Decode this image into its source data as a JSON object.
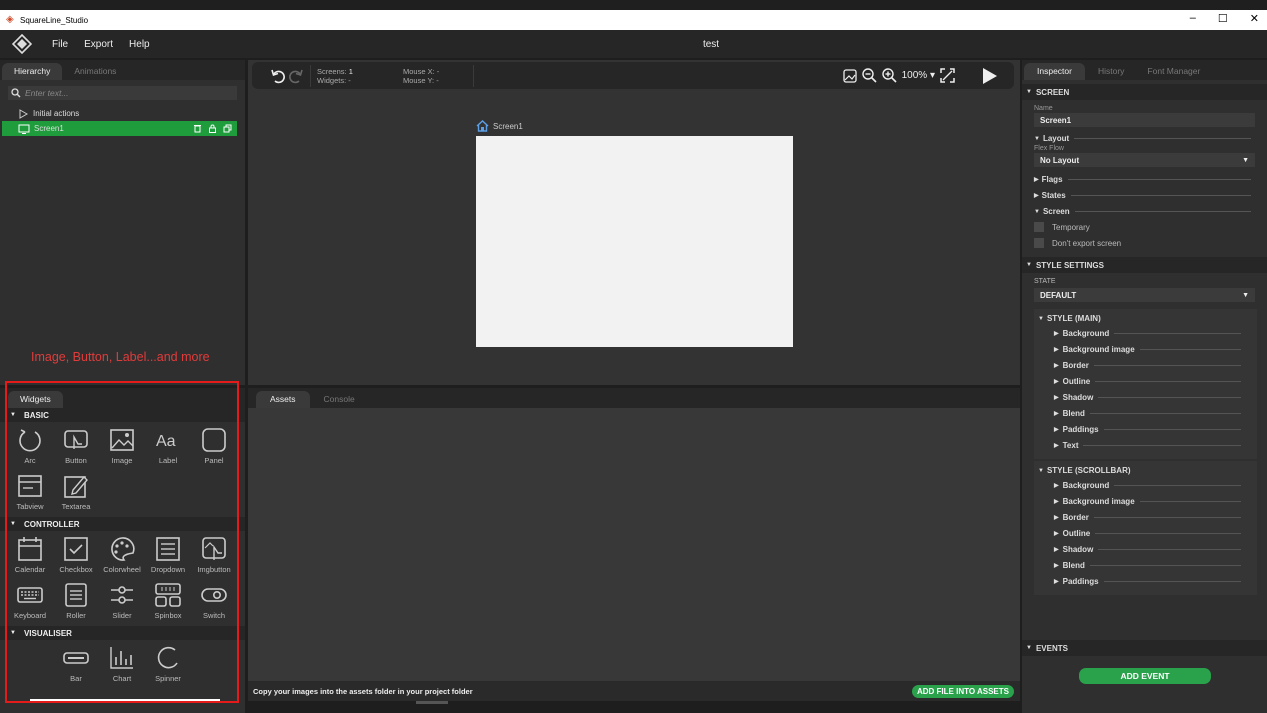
{
  "window": {
    "title": "SquareLine_Studio",
    "min": "–",
    "max": "☐",
    "close": "✕"
  },
  "menu": {
    "items": [
      "File",
      "Export",
      "Help"
    ],
    "project_name": "test"
  },
  "left": {
    "tabs": [
      "Hierarchy",
      "Animations"
    ],
    "search_placeholder": "Enter text...",
    "tree": [
      {
        "label": "Initial actions"
      },
      {
        "label": "Screen1"
      }
    ],
    "annotation": "Image, Button, Label...and more"
  },
  "widgets": {
    "tab": "Widgets",
    "sections": [
      {
        "title": "BASIC",
        "items": [
          {
            "label": "Arc",
            "icon": "arc-icon"
          },
          {
            "label": "Button",
            "icon": "button-icon"
          },
          {
            "label": "Image",
            "icon": "image-icon"
          },
          {
            "label": "Label",
            "icon": "label-icon"
          },
          {
            "label": "Panel",
            "icon": "panel-icon"
          },
          {
            "label": "Tabview",
            "icon": "tabview-icon"
          },
          {
            "label": "Textarea",
            "icon": "textarea-icon"
          }
        ]
      },
      {
        "title": "CONTROLLER",
        "items": [
          {
            "label": "Calendar",
            "icon": "calendar-icon"
          },
          {
            "label": "Checkbox",
            "icon": "checkbox-icon"
          },
          {
            "label": "Colorwheel",
            "icon": "colorwheel-icon"
          },
          {
            "label": "Dropdown",
            "icon": "dropdown-icon"
          },
          {
            "label": "Imgbutton",
            "icon": "imgbutton-icon"
          },
          {
            "label": "Keyboard",
            "icon": "keyboard-icon"
          },
          {
            "label": "Roller",
            "icon": "roller-icon"
          },
          {
            "label": "Slider",
            "icon": "slider-icon"
          },
          {
            "label": "Spinbox",
            "icon": "spinbox-icon"
          },
          {
            "label": "Switch",
            "icon": "switch-icon"
          }
        ]
      },
      {
        "title": "VISUALISER",
        "items": [
          {
            "label": "Bar",
            "icon": "bar-icon"
          },
          {
            "label": "Chart",
            "icon": "chart-icon"
          },
          {
            "label": "Spinner",
            "icon": "spinner-icon"
          }
        ]
      }
    ]
  },
  "canvas": {
    "screens_label": "Screens:",
    "screens_value": "1",
    "widgets_label": "Widgets:",
    "widgets_value": "-",
    "mouse_x": "Mouse X: -",
    "mouse_y": "Mouse Y: -",
    "zoom": "100%",
    "screen_name": "Screen1"
  },
  "assets": {
    "tabs": [
      "Assets",
      "Console"
    ],
    "hint": "Copy your images into the assets folder in your project folder",
    "add_button": "ADD FILE INTO ASSETS"
  },
  "inspector": {
    "tabs": [
      "Inspector",
      "History",
      "Font Manager"
    ],
    "screen_section": "SCREEN",
    "name_label": "Name",
    "name_value": "Screen1",
    "layout": "Layout",
    "flex_flow": "Flex Flow",
    "layout_value": "No Layout",
    "flags": "Flags",
    "states": "States",
    "screen": "Screen",
    "temporary": "Temporary",
    "dont_export": "Don't export screen",
    "style_settings": "STYLE SETTINGS",
    "state_label": "STATE",
    "state_value": "DEFAULT",
    "style_main": "STYLE (MAIN)",
    "style_main_items": [
      "Background",
      "Background image",
      "Border",
      "Outline",
      "Shadow",
      "Blend",
      "Paddings",
      "Text"
    ],
    "style_scroll": "STYLE (SCROLLBAR)",
    "style_scroll_items": [
      "Background",
      "Background image",
      "Border",
      "Outline",
      "Shadow",
      "Blend",
      "Paddings"
    ],
    "events": "EVENTS",
    "add_event": "ADD EVENT"
  },
  "colors": {
    "accent_green": "#2aa24b",
    "annotation_red": "#e23b3b"
  }
}
